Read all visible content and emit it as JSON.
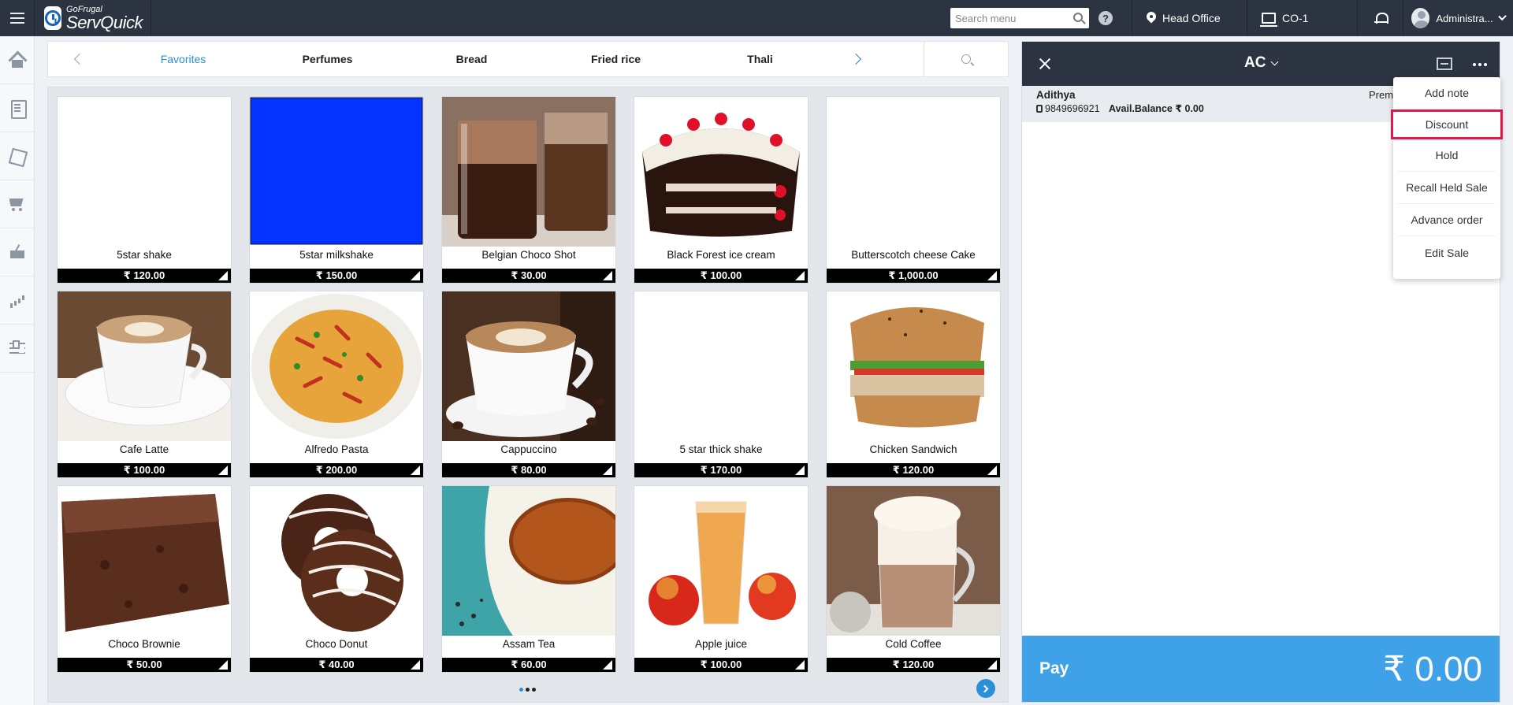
{
  "header": {
    "brand_top": "GoFrugal",
    "brand_name": "ServQuick",
    "search_placeholder": "Search menu",
    "help": "?",
    "location": "Head Office",
    "counter": "CO-1",
    "user": "Administra..."
  },
  "categories": {
    "tabs": [
      "Favorites",
      "Perfumes",
      "Bread",
      "Fried rice",
      "Thali"
    ],
    "active": "Favorites"
  },
  "colors": {
    "accent": "#2b8fd8",
    "topbar": "#2b3440",
    "pay": "#3fa2e8",
    "highlight": "#e2174a"
  },
  "products": [
    {
      "name": "5star shake",
      "price": "₹ 120.00",
      "image": "blank"
    },
    {
      "name": "5star milkshake",
      "price": "₹ 150.00",
      "image": "blue-square"
    },
    {
      "name": "Belgian Choco Shot",
      "price": "₹ 30.00",
      "image": "choco-shot-photo"
    },
    {
      "name": "Black Forest ice cream",
      "price": "₹ 100.00",
      "image": "black-forest-photo"
    },
    {
      "name": "Butterscotch cheese Cake",
      "price": "₹ 1,000.00",
      "image": "blank"
    },
    {
      "name": "Cafe Latte",
      "price": "₹ 100.00",
      "image": "latte-photo"
    },
    {
      "name": "Alfredo Pasta",
      "price": "₹ 200.00",
      "image": "pasta-photo"
    },
    {
      "name": "Cappuccino",
      "price": "₹ 80.00",
      "image": "cappuccino-photo"
    },
    {
      "name": "5 star thick shake",
      "price": "₹ 170.00",
      "image": "blank"
    },
    {
      "name": "Chicken Sandwich",
      "price": "₹ 120.00",
      "image": "sandwich-photo"
    },
    {
      "name": "Choco Brownie",
      "price": "₹ 50.00",
      "image": "brownie-photo"
    },
    {
      "name": "Choco Donut",
      "price": "₹ 40.00",
      "image": "donut-photo"
    },
    {
      "name": "Assam Tea",
      "price": "₹ 60.00",
      "image": "tea-photo"
    },
    {
      "name": "Apple juice",
      "price": "₹ 100.00",
      "image": "juice-photo"
    },
    {
      "name": "Cold Coffee",
      "price": "₹ 120.00",
      "image": "cold-coffee-photo"
    }
  ],
  "pagination": {
    "pages": 3,
    "current": 1
  },
  "order": {
    "type": "AC",
    "customer": {
      "name": "Adithya",
      "phone": "9849696921",
      "balance": "Avail.Balance ₹ 0.00",
      "tier": "Prem"
    },
    "pay_label": "Pay",
    "total": "₹ 0.00"
  },
  "menu": {
    "items": [
      "Add note",
      "Discount",
      "Hold",
      "Recall Held Sale",
      "Advance order",
      "Edit Sale"
    ],
    "highlighted": "Discount"
  }
}
